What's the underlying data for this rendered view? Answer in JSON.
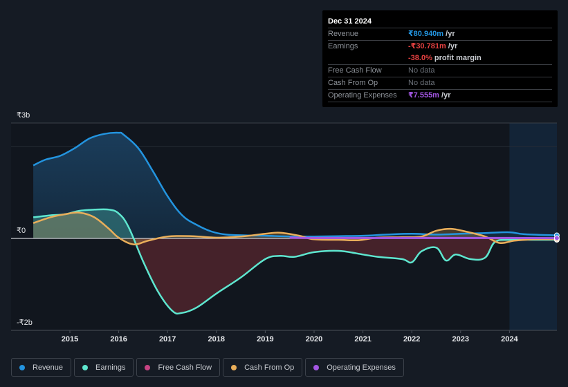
{
  "tooltip": {
    "date": "Dec 31 2024",
    "rows": [
      {
        "label": "Revenue",
        "value": "₹80.940m",
        "unit": " /yr",
        "color": "#2394df"
      },
      {
        "label": "Earnings",
        "value": "-₹30.781m",
        "unit": " /yr",
        "color": "#e64141"
      },
      {
        "label": "",
        "value": "-38.0%",
        "unit": " profit margin",
        "color": "#e64141"
      },
      {
        "label": "Free Cash Flow",
        "value": "No data",
        "unit": "",
        "color": "#6b7078"
      },
      {
        "label": "Cash From Op",
        "value": "No data",
        "unit": "",
        "color": "#6b7078"
      },
      {
        "label": "Operating Expenses",
        "value": "₹7.555m",
        "unit": " /yr",
        "color": "#a356e3"
      }
    ]
  },
  "legend": [
    {
      "label": "Revenue",
      "color": "#2394df"
    },
    {
      "label": "Earnings",
      "color": "#5ee6cf"
    },
    {
      "label": "Free Cash Flow",
      "color": "#c74383"
    },
    {
      "label": "Cash From Op",
      "color": "#e9ae5a"
    },
    {
      "label": "Operating Expenses",
      "color": "#a356e3"
    }
  ],
  "chart_data": {
    "type": "area",
    "title": "",
    "xlabel": "",
    "ylabel": "",
    "y_tick_labels": [
      "₹3b",
      "₹0",
      "-₹2b"
    ],
    "ylim": [
      -2.0,
      3.0
    ],
    "y_unit": "₹ billions",
    "x_tick_labels": [
      "2015",
      "2016",
      "2017",
      "2018",
      "2019",
      "2020",
      "2021",
      "2022",
      "2023",
      "2024"
    ],
    "xlim": [
      2013.6,
      2025.0
    ],
    "forecast_region_start": 2024.0,
    "grid": true,
    "legend_position": "bottom",
    "series": [
      {
        "name": "Revenue",
        "color": "#2394df",
        "filled": true,
        "points": [
          [
            2014.25,
            1.9
          ],
          [
            2014.5,
            2.05
          ],
          [
            2014.8,
            2.15
          ],
          [
            2015.1,
            2.35
          ],
          [
            2015.4,
            2.6
          ],
          [
            2015.7,
            2.72
          ],
          [
            2016.0,
            2.75
          ],
          [
            2016.1,
            2.7
          ],
          [
            2016.4,
            2.35
          ],
          [
            2016.7,
            1.75
          ],
          [
            2017.0,
            1.1
          ],
          [
            2017.3,
            0.6
          ],
          [
            2017.6,
            0.35
          ],
          [
            2017.9,
            0.18
          ],
          [
            2018.2,
            0.1
          ],
          [
            2018.6,
            0.08
          ],
          [
            2019.0,
            0.07
          ],
          [
            2019.5,
            0.05
          ],
          [
            2020.0,
            0.05
          ],
          [
            2020.5,
            0.06
          ],
          [
            2021.0,
            0.07
          ],
          [
            2021.5,
            0.1
          ],
          [
            2022.0,
            0.12
          ],
          [
            2022.5,
            0.1
          ],
          [
            2023.0,
            0.12
          ],
          [
            2023.5,
            0.14
          ],
          [
            2024.0,
            0.16
          ],
          [
            2024.3,
            0.11
          ],
          [
            2024.97,
            0.08
          ]
        ]
      },
      {
        "name": "Earnings",
        "color": "#5ee6cf",
        "filled": true,
        "points": [
          [
            2014.25,
            0.55
          ],
          [
            2014.6,
            0.6
          ],
          [
            2014.9,
            0.63
          ],
          [
            2015.2,
            0.72
          ],
          [
            2015.5,
            0.75
          ],
          [
            2015.8,
            0.75
          ],
          [
            2016.0,
            0.65
          ],
          [
            2016.2,
            0.3
          ],
          [
            2016.5,
            -0.5
          ],
          [
            2016.8,
            -1.15
          ],
          [
            2017.1,
            -1.58
          ],
          [
            2017.3,
            -1.62
          ],
          [
            2017.6,
            -1.5
          ],
          [
            2018.0,
            -1.2
          ],
          [
            2018.5,
            -0.85
          ],
          [
            2019.0,
            -0.45
          ],
          [
            2019.3,
            -0.38
          ],
          [
            2019.6,
            -0.4
          ],
          [
            2020.0,
            -0.3
          ],
          [
            2020.5,
            -0.27
          ],
          [
            2021.0,
            -0.35
          ],
          [
            2021.3,
            -0.4
          ],
          [
            2021.8,
            -0.45
          ],
          [
            2022.0,
            -0.52
          ],
          [
            2022.2,
            -0.28
          ],
          [
            2022.5,
            -0.2
          ],
          [
            2022.7,
            -0.48
          ],
          [
            2022.9,
            -0.35
          ],
          [
            2023.2,
            -0.45
          ],
          [
            2023.5,
            -0.42
          ],
          [
            2023.7,
            -0.08
          ],
          [
            2024.0,
            -0.03
          ],
          [
            2024.5,
            -0.03
          ],
          [
            2024.97,
            -0.03
          ]
        ]
      },
      {
        "name": "Free Cash Flow",
        "color": "#c74383",
        "filled": false,
        "points": []
      },
      {
        "name": "Cash From Op",
        "color": "#e9ae5a",
        "filled": true,
        "points": [
          [
            2014.25,
            0.4
          ],
          [
            2014.6,
            0.55
          ],
          [
            2014.9,
            0.63
          ],
          [
            2015.2,
            0.67
          ],
          [
            2015.5,
            0.55
          ],
          [
            2015.8,
            0.25
          ],
          [
            2016.0,
            0.02
          ],
          [
            2016.3,
            -0.13
          ],
          [
            2016.6,
            -0.05
          ],
          [
            2017.0,
            0.05
          ],
          [
            2017.5,
            0.06
          ],
          [
            2018.0,
            0.02
          ],
          [
            2018.5,
            0.05
          ],
          [
            2019.0,
            0.12
          ],
          [
            2019.3,
            0.15
          ],
          [
            2019.7,
            0.07
          ],
          [
            2020.0,
            -0.02
          ],
          [
            2020.5,
            -0.03
          ],
          [
            2020.9,
            -0.04
          ],
          [
            2021.3,
            0.02
          ],
          [
            2021.8,
            0.03
          ],
          [
            2022.2,
            0.05
          ],
          [
            2022.5,
            0.2
          ],
          [
            2022.8,
            0.25
          ],
          [
            2023.1,
            0.18
          ],
          [
            2023.5,
            0.05
          ],
          [
            2023.8,
            -0.1
          ],
          [
            2024.1,
            -0.05
          ],
          [
            2024.5,
            -0.02
          ],
          [
            2024.97,
            -0.02
          ]
        ]
      },
      {
        "name": "Operating Expenses",
        "color": "#a356e3",
        "filled": false,
        "points": [
          [
            2019.5,
            0.02
          ],
          [
            2020.0,
            0.01
          ],
          [
            2021.0,
            0.01
          ],
          [
            2022.0,
            0.01
          ],
          [
            2023.0,
            0.01
          ],
          [
            2024.0,
            0.01
          ],
          [
            2024.97,
            0.008
          ]
        ]
      }
    ]
  }
}
